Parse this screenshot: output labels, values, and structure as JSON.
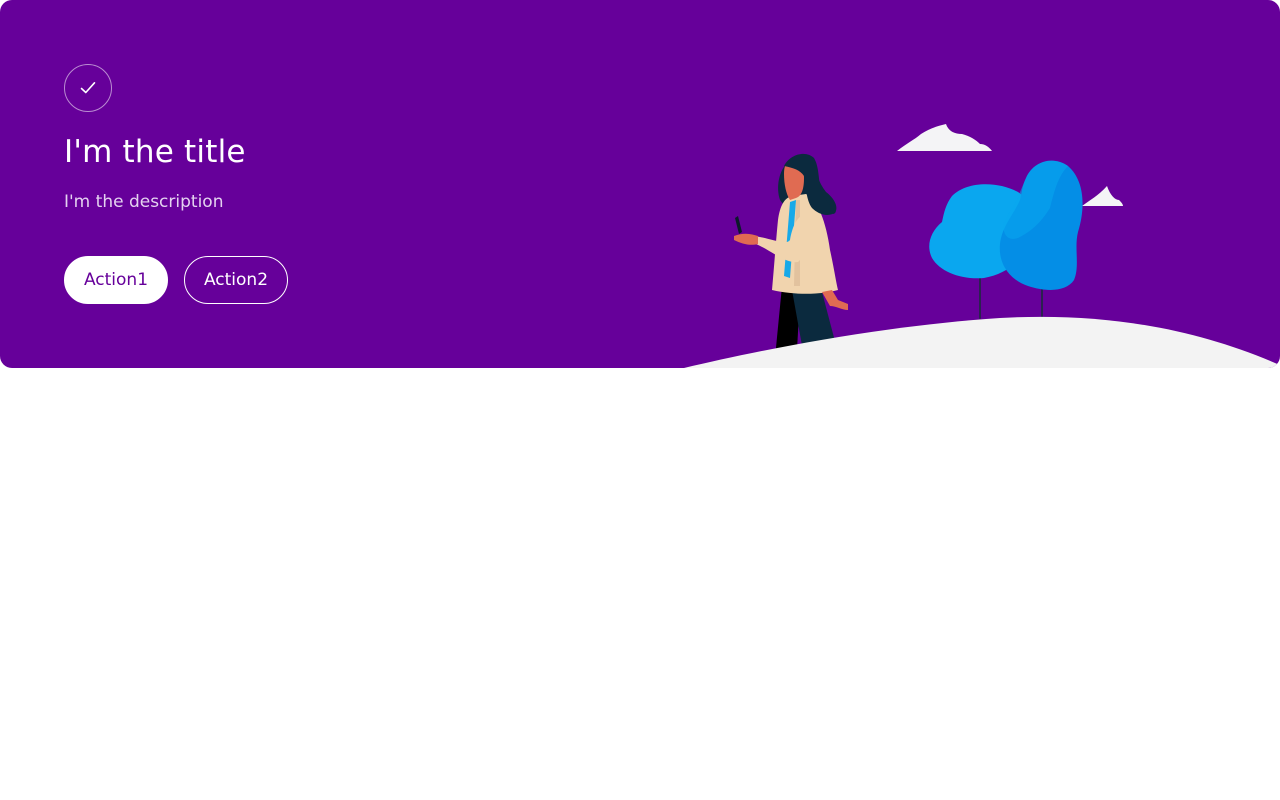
{
  "banner": {
    "title": "I'm the title",
    "description": "I'm the description",
    "icon": "checkmark-icon",
    "colors": {
      "background": "#66009a",
      "primary_button_bg": "#ffffff",
      "primary_button_text": "#66009a",
      "secondary_button_border": "#ffffff",
      "tree_light": "#0aa7ef",
      "tree_dark": "#048ee6",
      "hill": "#f3f3f3"
    }
  },
  "actions": {
    "primary_label": "Action1",
    "secondary_label": "Action2"
  },
  "illustration": {
    "elements": [
      "woman-walking-with-phone",
      "blue-trees",
      "clouds",
      "hill"
    ]
  }
}
